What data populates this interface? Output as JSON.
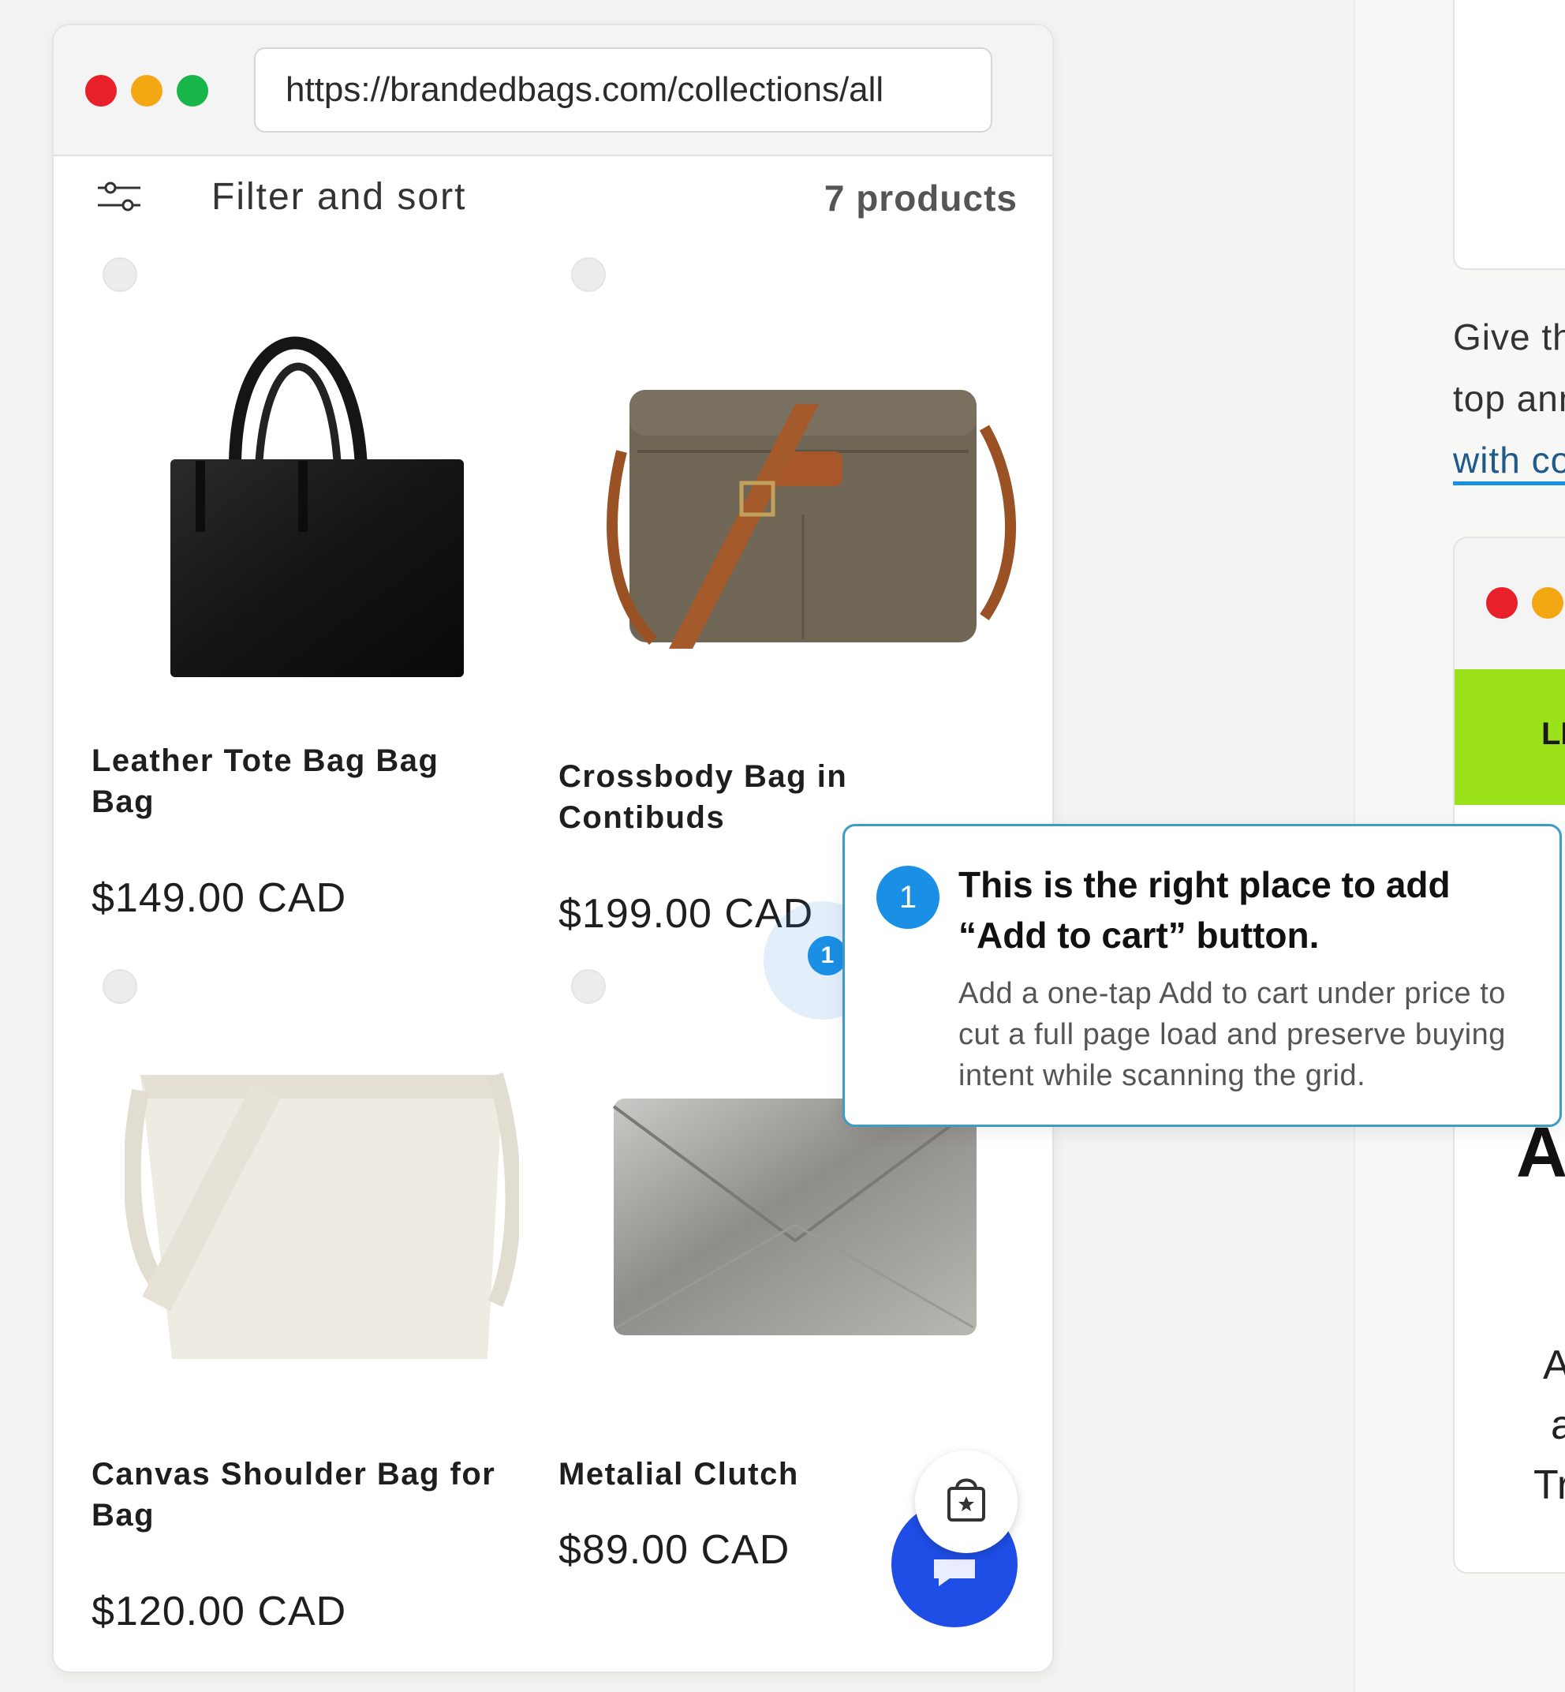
{
  "browser": {
    "url": "https://brandedbags.com/collections/all"
  },
  "toolbar": {
    "filter_label": "Filter and sort",
    "product_count": "7 products"
  },
  "products": [
    {
      "name_line1": "Leather Tote Bag Bag",
      "name_line2": "Bag",
      "price": "$149.00 CAD"
    },
    {
      "name_line1": "Crossbody Bag in",
      "name_line2": "Contibuds",
      "price": "$199.00 CAD"
    },
    {
      "name_line1": "Canvas Shoulder Bag for",
      "name_line2": "Bag",
      "price": "$120.00 CAD"
    },
    {
      "name_line1": "Metalial Clutch",
      "name_line2": "",
      "price": "$89.00 CAD"
    }
  ],
  "annotation": {
    "marker_number": "1",
    "callout_number": "1",
    "title": "This is the right place to add “Add to cart” button.",
    "body": "Add a one-tap Add to cart under price to cut a full page load and preserve buying intent while scanning the grid."
  },
  "right_panel": {
    "line1": "Give th",
    "line2": "top ann",
    "link": "with co",
    "bar_text": "LI",
    "big_letter": "A",
    "small1": "A",
    "small2": "a",
    "small3": "Tr"
  },
  "colors": {
    "accent_blue": "#1a8fe6",
    "callout_border": "#3e9cc2",
    "fab_blue": "#1f4ee6",
    "traffic_red": "#e8202a",
    "traffic_yellow": "#f2a713",
    "traffic_green": "#18b549",
    "lime_bar": "#9be21a"
  },
  "icons": [
    "filter-sliders-icon",
    "wishlist-icon",
    "shopping-bag-icon",
    "chat-icon"
  ]
}
